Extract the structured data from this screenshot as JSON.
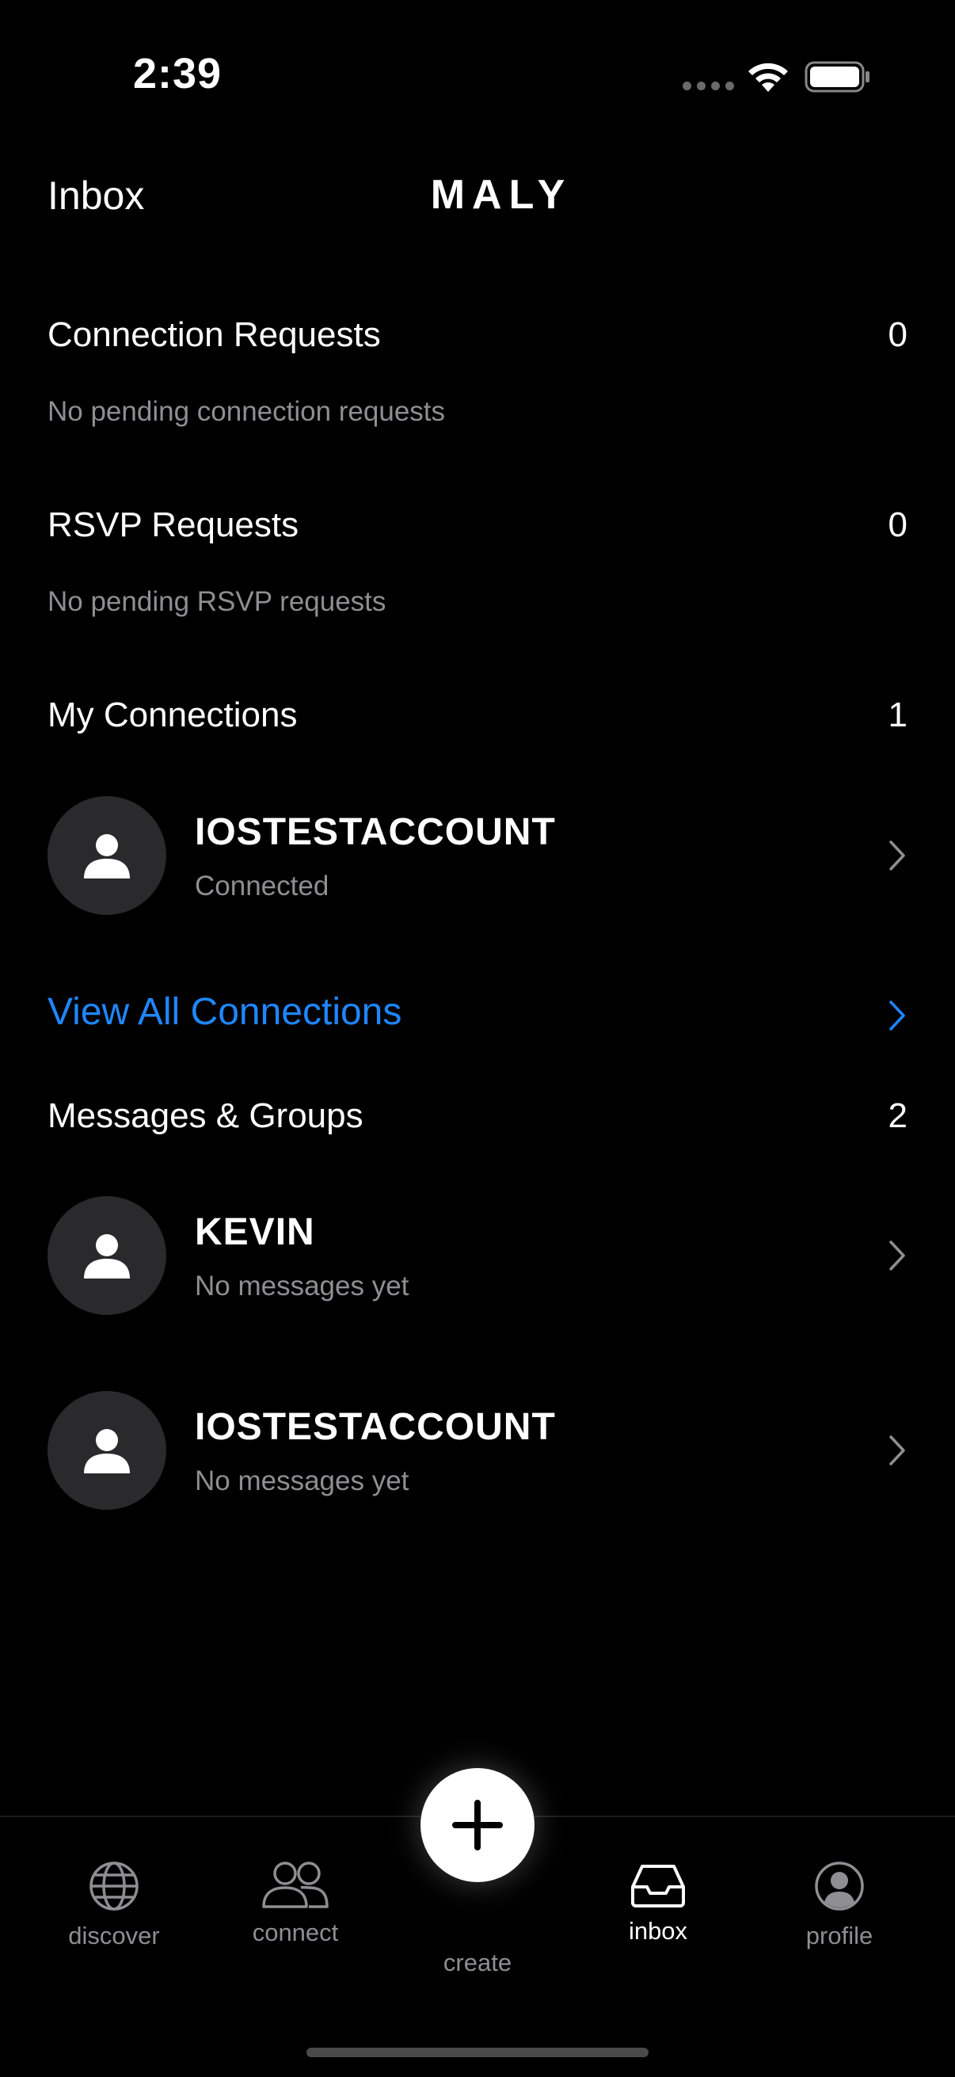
{
  "status_bar": {
    "time": "2:39",
    "icons": [
      "signal-icon",
      "wifi-icon",
      "battery-icon"
    ]
  },
  "header": {
    "title": "Inbox",
    "brand": "MALY"
  },
  "connection_requests": {
    "title": "Connection Requests",
    "count": "0",
    "empty_text": "No pending connection requests"
  },
  "rsvp_requests": {
    "title": "RSVP Requests",
    "count": "0",
    "empty_text": "No pending RSVP requests"
  },
  "my_connections": {
    "title": "My Connections",
    "count": "1",
    "items": [
      {
        "name": "IOSTESTACCOUNT",
        "status": "Connected"
      }
    ],
    "view_all_label": "View All Connections"
  },
  "messages_groups": {
    "title": "Messages & Groups",
    "count": "2",
    "items": [
      {
        "name": "KEVIN",
        "preview": "No messages yet"
      },
      {
        "name": "IOSTESTACCOUNT",
        "preview": "No messages yet"
      }
    ]
  },
  "tab_bar": {
    "tabs": [
      {
        "label": "discover",
        "icon": "globe-icon"
      },
      {
        "label": "connect",
        "icon": "people-icon"
      },
      {
        "label": "create",
        "icon": "plus-icon"
      },
      {
        "label": "inbox",
        "icon": "inbox-tray-icon",
        "active": true
      },
      {
        "label": "profile",
        "icon": "person-circle-icon"
      }
    ]
  },
  "colors": {
    "background": "#000000",
    "accent_link": "#1f86ff",
    "secondary_text": "#8e8e93",
    "avatar_bg": "#2a2a2c"
  }
}
